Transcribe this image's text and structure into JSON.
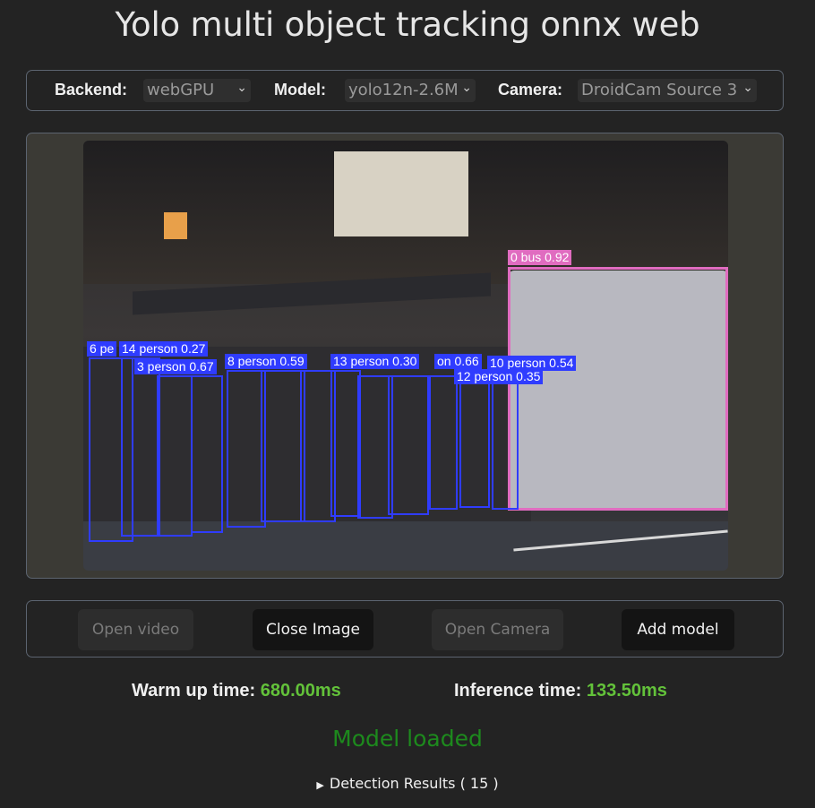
{
  "title": "Yolo multi object tracking onnx web",
  "settings": {
    "backend_label": "Backend:",
    "backend_value": "webGPU",
    "model_label": "Model:",
    "model_value": "yolo12n-2.6M",
    "camera_label": "Camera:",
    "camera_value": "DroidCam Source 3",
    "chevron_icon": "chevron-down-icon"
  },
  "detections": [
    {
      "label": "0 bus 0.92"
    },
    {
      "label": "6 pe"
    },
    {
      "label": "14 person 0.27"
    },
    {
      "label": "3 person 0.67"
    },
    {
      "label": "8 person 0.59"
    },
    {
      "label": "13 person 0.30"
    },
    {
      "label": "on 0.66"
    },
    {
      "label": "10 person 0.54"
    },
    {
      "label": "12 person 0.35"
    }
  ],
  "controls": {
    "open_video": "Open video",
    "close_image": "Close Image",
    "open_camera": "Open Camera",
    "add_model": "Add model"
  },
  "stats": {
    "warmup_label": "Warm up time: ",
    "warmup_value": "680.00ms",
    "inference_label": "Inference time: ",
    "inference_value": "133.50ms"
  },
  "status": "Model loaded",
  "results": {
    "label": "Detection Results ( 15 )",
    "icon": "triangle-right-icon"
  }
}
